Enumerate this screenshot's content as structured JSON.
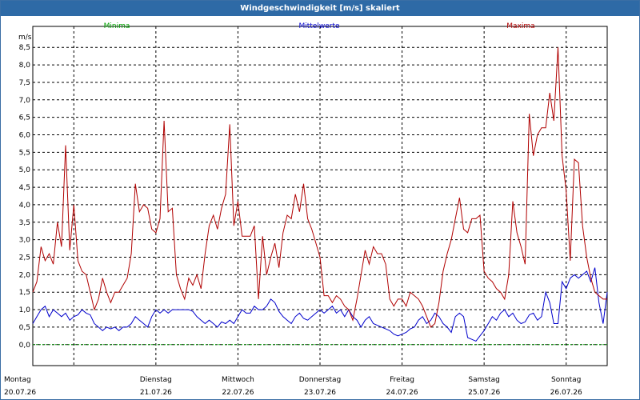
{
  "title": "Windgeschwindigkeit [m/s] skaliert",
  "chart_data": {
    "type": "line",
    "ylabel": "m/s",
    "ylim": [
      -0.6,
      9.1
    ],
    "yticks": [
      "8,5",
      "8,0",
      "7,5",
      "7,0",
      "6,5",
      "6,0",
      "5,5",
      "5,0",
      "4,5",
      "4,0",
      "3,5",
      "3,0",
      "2,5",
      "2,0",
      "1,5",
      "1,0",
      "0,5",
      "0,0"
    ],
    "ytick_values": [
      8.5,
      8.0,
      7.5,
      7.0,
      6.5,
      6.0,
      5.5,
      5.0,
      4.5,
      4.0,
      3.5,
      3.0,
      2.5,
      2.0,
      1.5,
      1.0,
      0.5,
      0.0
    ],
    "xlim": [
      0,
      7
    ],
    "day_positions": [
      0,
      1,
      2,
      3,
      4,
      5,
      6
    ],
    "days": [
      {
        "weekday": "Montag",
        "date": "20.07.26"
      },
      {
        "weekday": "Dienstag",
        "date": "21.07.26"
      },
      {
        "weekday": "Mittwoch",
        "date": "22.07.26"
      },
      {
        "weekday": "Donnerstag",
        "date": "23.07.26"
      },
      {
        "weekday": "Freitag",
        "date": "24.07.26"
      },
      {
        "weekday": "Samstag",
        "date": "25.07.26"
      },
      {
        "weekday": "Sonntag",
        "date": "26.07.26"
      }
    ],
    "grid": true,
    "series": [
      {
        "name": "Minima",
        "color": "#00a000",
        "x": [
          0,
          7
        ],
        "values": [
          0.0,
          0.0
        ]
      },
      {
        "name": "Mittelwerte",
        "color": "#0000cc",
        "x": [
          0.0,
          0.05,
          0.1,
          0.15,
          0.2,
          0.25,
          0.3,
          0.35,
          0.4,
          0.45,
          0.5,
          0.55,
          0.6,
          0.65,
          0.7,
          0.75,
          0.8,
          0.85,
          0.9,
          0.95,
          1.0,
          1.05,
          1.1,
          1.15,
          1.2,
          1.25,
          1.3,
          1.35,
          1.4,
          1.45,
          1.5,
          1.55,
          1.6,
          1.65,
          1.7,
          1.75,
          1.8,
          1.85,
          1.9,
          1.95,
          2.0,
          2.05,
          2.1,
          2.15,
          2.2,
          2.25,
          2.3,
          2.35,
          2.4,
          2.45,
          2.5,
          2.55,
          2.6,
          2.65,
          2.7,
          2.75,
          2.8,
          2.85,
          2.9,
          2.95,
          3.0,
          3.05,
          3.1,
          3.15,
          3.2,
          3.25,
          3.3,
          3.35,
          3.4,
          3.45,
          3.5,
          3.55,
          3.6,
          3.65,
          3.7,
          3.75,
          3.8,
          3.85,
          3.9,
          3.95,
          4.0,
          4.05,
          4.1,
          4.15,
          4.2,
          4.25,
          4.3,
          4.35,
          4.4,
          4.45,
          4.5,
          4.55,
          4.6,
          4.65,
          4.7,
          4.75,
          4.8,
          4.85,
          4.9,
          4.95,
          5.0,
          5.05,
          5.1,
          5.15,
          5.2,
          5.25,
          5.3,
          5.35,
          5.4,
          5.45,
          5.5,
          5.55,
          5.6,
          5.65,
          5.7,
          5.75,
          5.8,
          5.85,
          5.9,
          5.95,
          6.0,
          6.05,
          6.1,
          6.15,
          6.2,
          6.25,
          6.3,
          6.35,
          6.4,
          6.45,
          6.5,
          6.55,
          6.6,
          6.65,
          6.7,
          6.75,
          6.8,
          6.85,
          6.9,
          6.95,
          7.0
        ],
        "values": [
          0.6,
          0.8,
          1.0,
          1.1,
          0.8,
          1.0,
          0.9,
          0.8,
          0.9,
          0.7,
          0.8,
          0.85,
          1.0,
          0.9,
          0.85,
          0.6,
          0.5,
          0.4,
          0.5,
          0.45,
          0.5,
          0.4,
          0.5,
          0.5,
          0.6,
          0.8,
          0.7,
          0.6,
          0.5,
          0.8,
          1.0,
          0.9,
          1.0,
          0.9,
          1.0,
          1.0,
          1.0,
          1.0,
          1.0,
          0.95,
          0.8,
          0.7,
          0.6,
          0.7,
          0.6,
          0.5,
          0.65,
          0.6,
          0.7,
          0.6,
          0.8,
          1.0,
          0.9,
          0.9,
          1.1,
          1.0,
          1.0,
          1.1,
          1.3,
          1.2,
          0.95,
          0.8,
          0.7,
          0.6,
          0.8,
          0.9,
          0.75,
          0.7,
          0.8,
          0.9,
          1.0,
          0.9,
          1.0,
          1.1,
          0.9,
          1.0,
          0.8,
          1.0,
          0.8,
          0.7,
          0.5,
          0.7,
          0.8,
          0.6,
          0.55,
          0.5,
          0.45,
          0.4,
          0.3,
          0.25,
          0.3,
          0.35,
          0.45,
          0.5,
          0.7,
          0.8,
          0.6,
          0.7,
          0.9,
          0.8,
          0.6,
          0.5,
          0.35,
          0.8,
          0.9,
          0.8,
          0.2,
          0.15,
          0.1,
          0.25,
          0.4,
          0.6,
          0.8,
          0.7,
          0.9,
          1.0,
          0.8,
          0.9,
          0.7,
          0.6,
          0.65,
          0.85,
          0.9,
          0.7,
          0.8,
          1.5,
          1.2,
          0.6,
          0.6,
          1.8,
          1.6,
          1.9,
          2.0,
          1.9,
          2.0,
          2.1,
          1.8,
          2.2,
          1.2,
          0.6,
          1.5
        ]
      },
      {
        "name": "Maxima",
        "color": "#b00000",
        "x": [
          0.0,
          0.05,
          0.1,
          0.15,
          0.2,
          0.25,
          0.3,
          0.35,
          0.4,
          0.45,
          0.5,
          0.55,
          0.6,
          0.65,
          0.7,
          0.75,
          0.8,
          0.85,
          0.9,
          0.95,
          1.0,
          1.05,
          1.1,
          1.15,
          1.2,
          1.25,
          1.3,
          1.35,
          1.4,
          1.45,
          1.5,
          1.55,
          1.6,
          1.65,
          1.7,
          1.75,
          1.8,
          1.85,
          1.9,
          1.95,
          2.0,
          2.05,
          2.1,
          2.15,
          2.2,
          2.25,
          2.3,
          2.35,
          2.4,
          2.45,
          2.5,
          2.55,
          2.6,
          2.65,
          2.7,
          2.75,
          2.8,
          2.85,
          2.9,
          2.95,
          3.0,
          3.05,
          3.1,
          3.15,
          3.2,
          3.25,
          3.3,
          3.35,
          3.4,
          3.45,
          3.5,
          3.55,
          3.6,
          3.65,
          3.7,
          3.75,
          3.8,
          3.85,
          3.9,
          3.95,
          4.0,
          4.05,
          4.1,
          4.15,
          4.2,
          4.25,
          4.3,
          4.35,
          4.4,
          4.45,
          4.5,
          4.55,
          4.6,
          4.65,
          4.7,
          4.75,
          4.8,
          4.85,
          4.9,
          4.95,
          5.0,
          5.05,
          5.1,
          5.15,
          5.2,
          5.25,
          5.3,
          5.35,
          5.4,
          5.45,
          5.5,
          5.55,
          5.6,
          5.65,
          5.7,
          5.75,
          5.8,
          5.85,
          5.9,
          5.95,
          6.0,
          6.05,
          6.1,
          6.15,
          6.2,
          6.25,
          6.3,
          6.35,
          6.4,
          6.45,
          6.5,
          6.55,
          6.6,
          6.65,
          6.7,
          6.75,
          6.8,
          6.85,
          6.9,
          6.95,
          7.0
        ],
        "values": [
          1.5,
          1.8,
          2.8,
          2.4,
          2.6,
          2.3,
          3.5,
          2.8,
          5.7,
          2.7,
          4.0,
          2.4,
          2.1,
          2.0,
          1.5,
          1.0,
          1.3,
          1.9,
          1.5,
          1.2,
          1.5,
          1.5,
          1.7,
          1.9,
          2.6,
          4.6,
          3.8,
          4.0,
          3.9,
          3.3,
          3.2,
          3.6,
          6.4,
          3.8,
          3.9,
          2.0,
          1.6,
          1.3,
          1.9,
          1.7,
          2.0,
          1.6,
          2.6,
          3.4,
          3.7,
          3.3,
          3.9,
          4.3,
          6.3,
          3.4,
          4.1,
          3.1,
          3.1,
          3.1,
          3.4,
          1.3,
          3.1,
          2.0,
          2.5,
          2.9,
          2.2,
          3.2,
          3.7,
          3.6,
          4.3,
          3.8,
          4.6,
          3.6,
          3.3,
          2.9,
          2.5,
          1.4,
          1.4,
          1.2,
          1.4,
          1.3,
          1.1,
          1.0,
          0.7,
          1.3,
          2.0,
          2.7,
          2.3,
          2.8,
          2.6,
          2.6,
          2.3,
          1.3,
          1.1,
          1.3,
          1.3,
          1.1,
          1.5,
          1.4,
          1.3,
          1.1,
          0.8,
          0.5,
          0.6,
          1.2,
          2.1,
          2.6,
          3.0,
          3.6,
          4.2,
          3.3,
          3.2,
          3.6,
          3.6,
          3.7,
          2.1,
          1.9,
          1.8,
          1.6,
          1.5,
          1.3,
          2.0,
          4.1,
          3.2,
          2.8,
          2.3,
          6.6,
          5.4,
          6.0,
          6.2,
          6.2,
          7.2,
          6.4,
          8.5,
          5.4,
          4.4,
          2.4,
          5.3,
          5.2,
          3.4,
          2.5,
          1.9,
          1.5,
          1.4,
          1.3,
          1.3
        ]
      }
    ]
  }
}
